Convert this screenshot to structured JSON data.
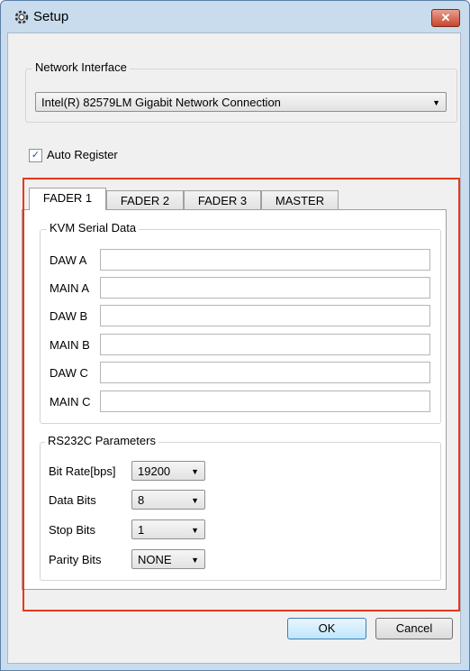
{
  "window": {
    "title": "Setup",
    "close_glyph": "✕"
  },
  "network": {
    "group_label": "Network Interface",
    "selected": "Intel(R) 82579LM Gigabit Network Connection"
  },
  "auto_register": {
    "label": "Auto Register",
    "checked": true
  },
  "tabs": [
    {
      "label": "FADER 1",
      "active": true
    },
    {
      "label": "FADER 2",
      "active": false
    },
    {
      "label": "FADER 3",
      "active": false
    },
    {
      "label": "MASTER",
      "active": false
    }
  ],
  "kvm": {
    "group_label": "KVM Serial Data",
    "fields": [
      {
        "label": "DAW A",
        "value": ""
      },
      {
        "label": "MAIN A",
        "value": ""
      },
      {
        "label": "DAW B",
        "value": ""
      },
      {
        "label": "MAIN B",
        "value": ""
      },
      {
        "label": "DAW C",
        "value": ""
      },
      {
        "label": "MAIN C",
        "value": ""
      }
    ]
  },
  "rs232c": {
    "group_label": "RS232C Parameters",
    "params": [
      {
        "label": "Bit Rate[bps]",
        "value": "19200"
      },
      {
        "label": "Data Bits",
        "value": "8"
      },
      {
        "label": "Stop Bits",
        "value": "1"
      },
      {
        "label": "Parity Bits",
        "value": "NONE"
      }
    ]
  },
  "buttons": {
    "ok": "OK",
    "cancel": "Cancel"
  },
  "colors": {
    "highlight": "#e8371c",
    "title_bg": "#c9dced",
    "default_button": "#bee6fd"
  },
  "icons": {
    "app": "settings-gear-icon",
    "close": "close-icon",
    "dropdown": "chevron-down-icon",
    "check": "checkmark-icon"
  }
}
